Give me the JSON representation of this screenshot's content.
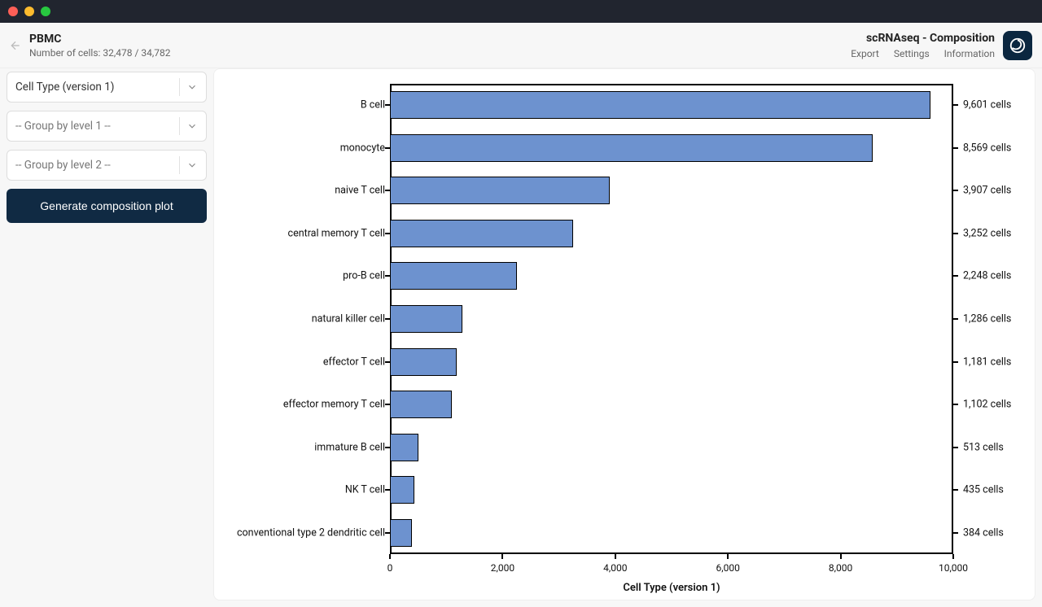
{
  "titlebar": {},
  "header": {
    "title": "PBMC",
    "subtitle": "Number of cells: 32,478 / 34,782",
    "module_title": "scRNAseq - Composition",
    "links": {
      "export": "Export",
      "settings": "Settings",
      "information": "Information"
    }
  },
  "sidebar": {
    "select1": "Cell Type (version 1)",
    "select2": "-- Group by level 1 --",
    "select3": "-- Group by level 2 --",
    "generate": "Generate composition plot"
  },
  "chart_data": {
    "type": "bar",
    "orientation": "horizontal",
    "xlabel": "Cell Type (version 1)",
    "xlim": [
      0,
      10000
    ],
    "xticks": [
      0,
      2000,
      4000,
      6000,
      8000,
      10000
    ],
    "xtick_labels": [
      "0",
      "2,000",
      "4,000",
      "6,000",
      "8,000",
      "10,000"
    ],
    "value_suffix": " cells",
    "categories": [
      "B cell",
      "monocyte",
      "naive T cell",
      "central memory T cell",
      "pro-B cell",
      "natural killer cell",
      "effector T cell",
      "effector memory T cell",
      "immature B cell",
      "NK T cell",
      "conventional type 2 dendritic cell"
    ],
    "values": [
      9601,
      8569,
      3907,
      3252,
      2248,
      1286,
      1181,
      1102,
      513,
      435,
      384
    ],
    "value_labels": [
      "9,601",
      "8,569",
      "3,907",
      "3,252",
      "2,248",
      "1,286",
      "1,181",
      "1,102",
      "513",
      "435",
      "384"
    ]
  }
}
